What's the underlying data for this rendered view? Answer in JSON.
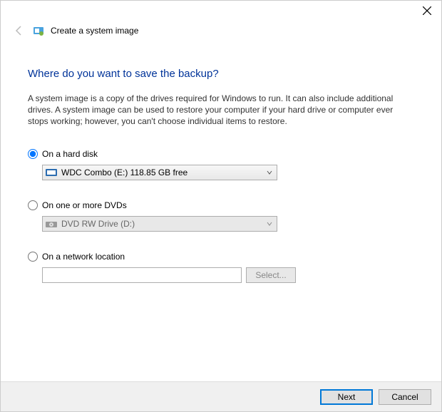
{
  "window": {
    "breadcrumb": "Create a system image"
  },
  "page": {
    "title": "Where do you want to save the backup?",
    "description": "A system image is a copy of the drives required for Windows to run. It can also include additional drives. A system image can be used to restore your computer if your hard drive or computer ever stops working; however, you can't choose individual items to restore."
  },
  "options": {
    "hard_disk": {
      "label": "On a hard disk",
      "selected": "WDC Combo (E:)  118.85 GB free"
    },
    "dvd": {
      "label": "On one or more DVDs",
      "selected": "DVD RW Drive (D:)"
    },
    "network": {
      "label": "On a network location",
      "value": "",
      "select_btn": "Select..."
    }
  },
  "footer": {
    "next": "Next",
    "cancel": "Cancel"
  }
}
